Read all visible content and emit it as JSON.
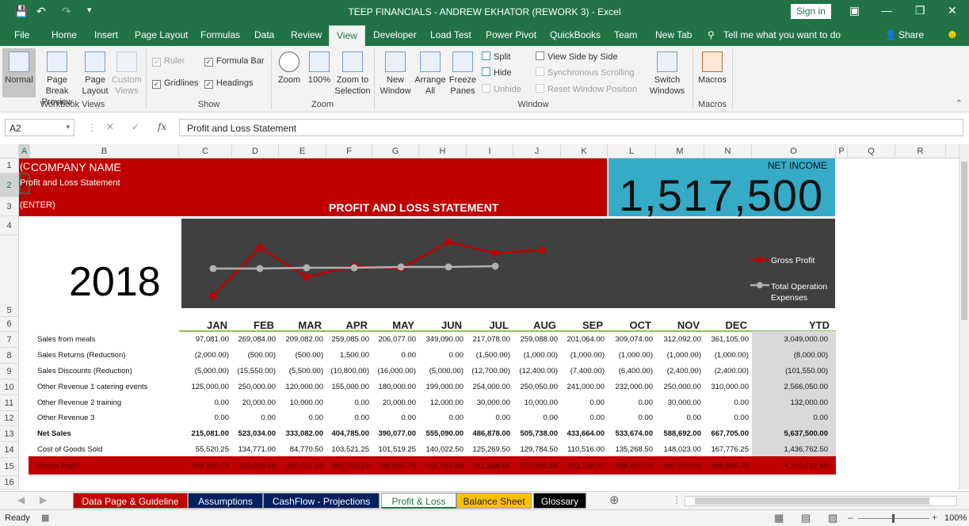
{
  "title": "TEEP FINANCIALS - ANDREW EKHATOR (REWORK 3)  -  Excel",
  "signin": "Sign in",
  "tabs": [
    "File",
    "Home",
    "Insert",
    "Page Layout",
    "Formulas",
    "Data",
    "Review",
    "View",
    "Developer",
    "Load Test",
    "Power Pivot",
    "QuickBooks",
    "Team",
    "New Tab"
  ],
  "tellme": "Tell me what you want to do",
  "share": "Share",
  "ribbon": {
    "workbook_views": {
      "label": "Workbook Views",
      "normal": "Normal",
      "page_break": "Page Break Preview",
      "page_layout": "Page Layout",
      "custom_views": "Custom Views"
    },
    "show": {
      "label": "Show",
      "ruler": "Ruler",
      "formula_bar": "Formula Bar",
      "gridlines": "Gridlines",
      "headings": "Headings"
    },
    "zoom": {
      "label": "Zoom",
      "zoom": "Zoom",
      "zoom100": "100%",
      "zoom_sel": "Zoom to Selection"
    },
    "window": {
      "label": "Window",
      "new_window": "New Window",
      "arrange_all": "Arrange All",
      "freeze_panes": "Freeze Panes",
      "split": "Split",
      "hide": "Hide",
      "unhide": "Unhide",
      "side_by_side": "View Side by Side",
      "sync_scroll": "Synchronous Scrolling",
      "reset_pos": "Reset Window Position",
      "switch": "Switch Windows"
    },
    "macros": {
      "label": "Macros",
      "macros": "Macros"
    }
  },
  "namebox": "A2",
  "formula": "Profit and Loss Statement",
  "columns": [
    "A",
    "B",
    "C",
    "D",
    "E",
    "F",
    "G",
    "H",
    "I",
    "J",
    "K",
    "L",
    "M",
    "N",
    "O",
    "P",
    "Q",
    "R"
  ],
  "rows": [
    "1",
    "2",
    "3",
    "4",
    "5",
    "6",
    "7",
    "8",
    "9",
    "10",
    "11",
    "12",
    "13",
    "14",
    "15",
    "16"
  ],
  "sheet": {
    "a1": "(C",
    "company": "COMPANY NAME",
    "subtitle": "Profit and Loss Statement",
    "enter": "(ENTER)",
    "banner": "PROFIT AND LOSS STATEMENT",
    "net_income_label": "NET INCOME",
    "net_income": "1,517,500",
    "year": "2018",
    "months": [
      "JAN",
      "FEB",
      "MAR",
      "APR",
      "MAY",
      "JUN",
      "JUL",
      "AUG",
      "SEP",
      "OCT",
      "NOV",
      "DEC"
    ],
    "ytd": "YTD",
    "rows": [
      {
        "label": "Sales from meals",
        "vals": [
          "97,081.00",
          "269,084.00",
          "209,082.00",
          "259,085.00",
          "206,077.00",
          "349,090.00",
          "217,078.00",
          "259,088.00",
          "201,064.00",
          "309,074.00",
          "312,092.00",
          "361,105.00"
        ],
        "ytd": "3,049,000.00",
        "bold": false
      },
      {
        "label": "Sales Returns (Reduction)",
        "vals": [
          "(2,000.00)",
          "(500.00)",
          "(500.00)",
          "1,500.00",
          "0.00",
          "0.00",
          "(1,500.00)",
          "(1,000.00)",
          "(1,000.00)",
          "(1,000.00)",
          "(1,000.00)",
          "(1,000.00)"
        ],
        "ytd": "(8,000.00)",
        "bold": false
      },
      {
        "label": "Sales Discounts (Reduction)",
        "vals": [
          "(5,000.00)",
          "(15,550.00)",
          "(5,500.00)",
          "(10,800.00)",
          "(16,000.00)",
          "(5,000.00)",
          "(12,700.00)",
          "(12,400.00)",
          "(7,400.00)",
          "(6,400.00)",
          "(2,400.00)",
          "(2,400.00)"
        ],
        "ytd": "(101,550.00)",
        "bold": false
      },
      {
        "label": "Other Revenue 1 catering events",
        "vals": [
          "125,000.00",
          "250,000.00",
          "120,000.00",
          "155,000.00",
          "180,000.00",
          "199,000.00",
          "254,000.00",
          "250,050.00",
          "241,000.00",
          "232,000.00",
          "250,000.00",
          "310,000.00"
        ],
        "ytd": "2,566,050.00",
        "bold": false
      },
      {
        "label": "Other Revenue 2 training",
        "vals": [
          "0.00",
          "20,000.00",
          "10,000.00",
          "0.00",
          "20,000.00",
          "12,000.00",
          "30,000.00",
          "10,000.00",
          "0.00",
          "0.00",
          "30,000.00",
          "0.00"
        ],
        "ytd": "132,000.00",
        "bold": false
      },
      {
        "label": "Other Revenue 3",
        "vals": [
          "0.00",
          "0.00",
          "0.00",
          "0.00",
          "0.00",
          "0.00",
          "0.00",
          "0.00",
          "0.00",
          "0.00",
          "0.00",
          "0.00"
        ],
        "ytd": "0.00",
        "bold": false
      },
      {
        "label": "Net Sales",
        "vals": [
          "215,081.00",
          "523,034.00",
          "333,082.00",
          "404,785.00",
          "390,077.00",
          "555,090.00",
          "486,878.00",
          "505,738.00",
          "433,664.00",
          "533,674.00",
          "588,692.00",
          "667,705.00"
        ],
        "ytd": "5,637,500.00",
        "bold": true
      },
      {
        "label": "Cost of Goods Sold",
        "vals": [
          "55,520.25",
          "134,771.00",
          "84,770.50",
          "103,521.25",
          "101,519.25",
          "140,022.50",
          "125,269.50",
          "129,784.50",
          "110,516.00",
          "135,268.50",
          "148,023.00",
          "167,776.25"
        ],
        "ytd": "1,436,762.50",
        "bold": false
      }
    ],
    "gross": {
      "label": "Gross Profit",
      "vals": [
        "159,560.75",
        "388,263.00",
        "248,311.50",
        "301,263.75",
        "288,557.75",
        "415,067.50",
        "361,608.50",
        "375,953.50",
        "323,148.00",
        "398,405.50",
        "440,669.00",
        "499,928.75"
      ],
      "ytd": "4,200,737.50"
    }
  },
  "chart_data": {
    "type": "line",
    "categories": [
      "JAN",
      "FEB",
      "MAR",
      "APR",
      "MAY",
      "JUN",
      "JUL",
      "AUG"
    ],
    "series": [
      {
        "name": "Gross Profit",
        "values": [
          159560.75,
          388263.0,
          248311.5,
          301263.75,
          288557.75,
          415067.5,
          361608.5,
          375953.5
        ],
        "color": "#c00000",
        "note_points": "8 visible markers"
      },
      {
        "name": "Total Operation Expenses",
        "values": [
          null,
          null,
          null,
          null,
          null,
          null,
          null
        ],
        "color": "#b0b0b0"
      }
    ]
  },
  "sheet_tabs": [
    {
      "label": "Data Page & Guideline",
      "bg": "#c00000",
      "fg": "#ffffff"
    },
    {
      "label": "Assumptions",
      "bg": "#002060",
      "fg": "#ffffff"
    },
    {
      "label": "CashFlow - Projections",
      "bg": "#002060",
      "fg": "#ffffff"
    },
    {
      "label": "Profit & Loss",
      "bg": "#ffffff",
      "fg": "#217346"
    },
    {
      "label": "Balance Sheet",
      "bg": "#ffc000",
      "fg": "#222222"
    },
    {
      "label": "Glossary",
      "bg": "#000000",
      "fg": "#ffffff"
    }
  ],
  "status": {
    "ready": "Ready",
    "zoom": "100%"
  }
}
